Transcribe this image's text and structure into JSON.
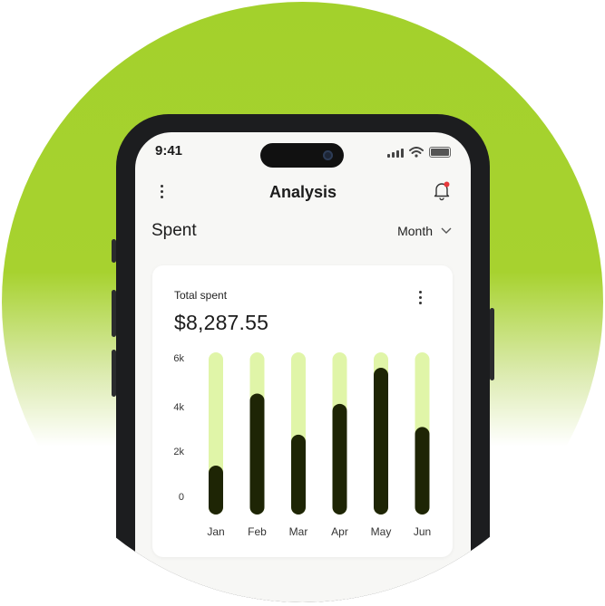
{
  "status_bar": {
    "time": "9:41"
  },
  "header": {
    "title": "Analysis"
  },
  "section": {
    "title": "Spent",
    "period": "Month"
  },
  "card": {
    "label": "Total spent",
    "amount": "$8,287.55"
  },
  "colors": {
    "track": "#e0f5a8",
    "bar": "#1e2505",
    "background_green": "#a3d12c"
  },
  "icons": [
    "more-vertical-icon",
    "bell-icon",
    "notification-dot",
    "chevron-down-icon",
    "signal-icon",
    "wifi-icon",
    "battery-icon"
  ],
  "chart_data": {
    "type": "bar",
    "categories": [
      "Jan",
      "Feb",
      "Mar",
      "Apr",
      "May",
      "Jun"
    ],
    "values": [
      1900,
      4700,
      3100,
      4300,
      5700,
      3400
    ],
    "y_ticks": [
      "0",
      "2k",
      "4k",
      "6k"
    ],
    "ylim": [
      0,
      6300
    ],
    "grid": false
  }
}
